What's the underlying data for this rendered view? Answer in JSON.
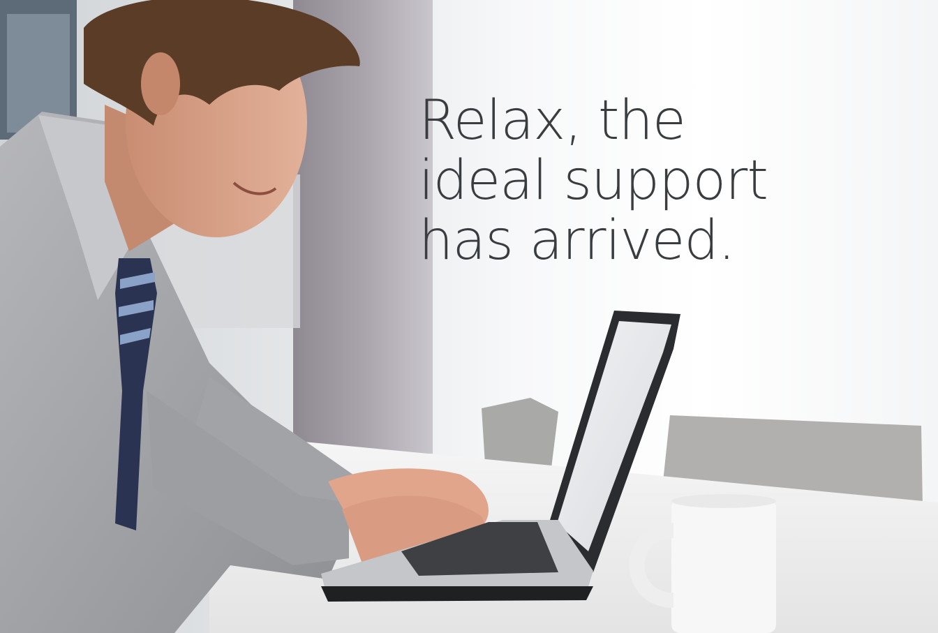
{
  "hero": {
    "headline_lines": [
      "Relax, the",
      "ideal support",
      "has arrived."
    ]
  }
}
